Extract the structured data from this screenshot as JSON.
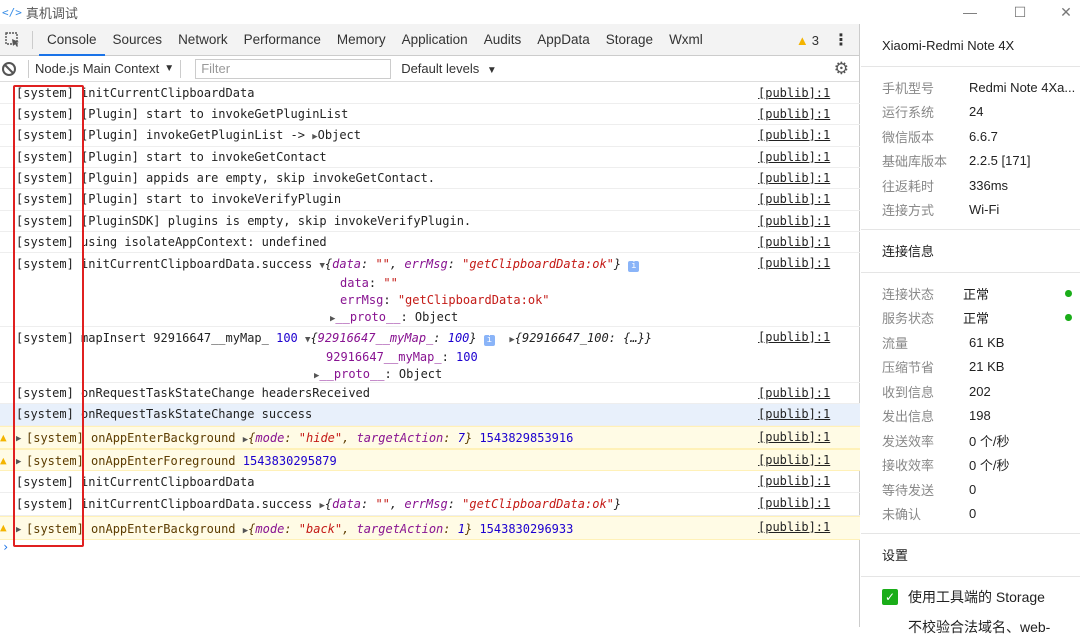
{
  "window": {
    "app_icon": "</>",
    "title": "真机调试"
  },
  "tabs": [
    "Console",
    "Sources",
    "Network",
    "Performance",
    "Memory",
    "Application",
    "Audits",
    "AppData",
    "Storage",
    "Wxml"
  ],
  "warning_count": "3",
  "toolbar": {
    "context": "Node.js Main Context",
    "filter_placeholder": "Filter",
    "levels": "Default levels"
  },
  "source_label": "[publib]:1",
  "log": {
    "r1": "[system] initCurrentClipboardData",
    "r2": "[system] [Plugin] start to invokeGetPluginList",
    "r3": "[system] [Plugin] invokeGetPluginList -> ",
    "r3b": "Object",
    "r4": "[system] [Plugin] start to invokeGetContact",
    "r5": "[system] [Plguin] appids are empty, skip invokeGetContact.",
    "r6": "[system] [Plugin] start to invokeVerifyPlugin",
    "r7": "[system] [PluginSDK] plugins is empty, skip invokeVerifyPlugin.",
    "r8": "[system] using isolateAppContext: undefined",
    "r9": "[system] initCurrentClipboardData.success ",
    "r10": "[system] mapInsert 92916647__myMap_ ",
    "r11": "[system] onRequestTaskStateChange headersReceived",
    "r12": "[system] onRequestTaskStateChange success",
    "r13": "[system] onAppEnterBackground ",
    "r14": "[system] onAppEnterForeground ",
    "r15": "[system] initCurrentClipboardData",
    "r16": "[system] initCurrentClipboardData.success ",
    "r17": "[system] onAppEnterBackground "
  },
  "tokens": {
    "data": "data",
    "errMsg": "errMsg",
    "empty": "\"\"",
    "ok": "\"getClipboardData:ok\"",
    "proto": "__proto__",
    "object": "Object",
    "hundred": "100",
    "mapkey": "92916647__myMap_",
    "mode": "mode",
    "targetAction": "targetAction",
    "hide": "\"hide\"",
    "back": "\"back\"",
    "seven": "7",
    "one": "1",
    "ts1": "1543829853916",
    "ts2": "1543830295879",
    "ts3": "1543830296933",
    "map_summary": "{92916647_100: {…}}"
  },
  "device": {
    "name": "Xiaomi-Redmi Note 4X"
  },
  "device_info": [
    {
      "k": "手机型号",
      "v": "Redmi Note 4Xa..."
    },
    {
      "k": "运行系统",
      "v": "24"
    },
    {
      "k": "微信版本",
      "v": "6.6.7"
    },
    {
      "k": "基础库版本",
      "v": "2.2.5 [171]"
    },
    {
      "k": "往返耗时",
      "v": "336ms"
    },
    {
      "k": "连接方式",
      "v": "Wi-Fi"
    }
  ],
  "conn_title": "连接信息",
  "conn_info": [
    {
      "k": "连接状态",
      "v": "正常"
    },
    {
      "k": "服务状态",
      "v": "正常"
    },
    {
      "k": "流量",
      "v": "61 KB"
    },
    {
      "k": "压缩节省",
      "v": "21 KB"
    },
    {
      "k": "收到信息",
      "v": "202"
    },
    {
      "k": "发出信息",
      "v": "198"
    },
    {
      "k": "发送效率",
      "v": "0 个/秒"
    },
    {
      "k": "接收效率",
      "v": "0 个/秒"
    },
    {
      "k": "等待发送",
      "v": "0"
    },
    {
      "k": "未确认",
      "v": "0"
    }
  ],
  "settings": {
    "title": "设置",
    "use_tool_storage": "使用工具端的 Storage",
    "no_verify": "不校验合法域名、web-"
  },
  "colors": {
    "accent": "#1a73e8",
    "ok_green": "#1aad19",
    "warning": "#f4b400",
    "highlight_red": "#e02020"
  }
}
